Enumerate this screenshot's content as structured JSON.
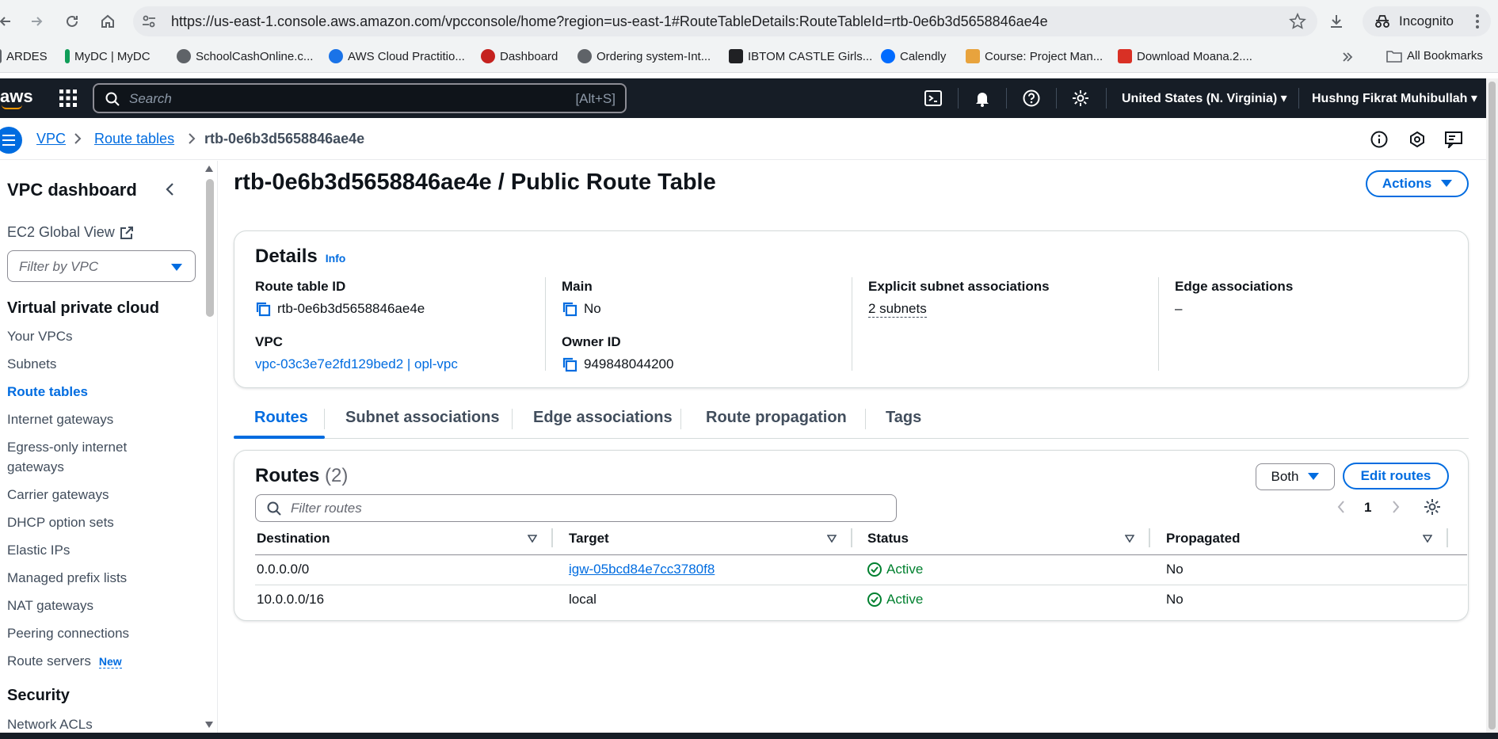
{
  "browser": {
    "url": "https://us-east-1.console.aws.amazon.com/vpcconsole/home?region=us-east-1#RouteTableDetails:RouteTableId=rtb-0e6b3d5658846ae4e",
    "profile_label": "Incognito",
    "bookmarks": [
      {
        "label": "ARDES",
        "color": "#5f6368"
      },
      {
        "label": "MyDC | MyDC",
        "color": "#0f9d58"
      },
      {
        "label": "SchoolCashOnline.c...",
        "color": "#5f6368"
      },
      {
        "label": "AWS Cloud Practitio...",
        "color": "#1a73e8"
      },
      {
        "label": "Dashboard",
        "color": "#c5221f"
      },
      {
        "label": "Ordering system-Int...",
        "color": "#5f6368"
      },
      {
        "label": "IBTOM CASTLE Girls...",
        "color": "#202124"
      },
      {
        "label": "Calendly",
        "color": "#006bff"
      },
      {
        "label": "Course: Project Man...",
        "color": "#e8a33d"
      },
      {
        "label": "Download Moana.2....",
        "color": "#d93025"
      }
    ],
    "all_bookmarks_label": "All Bookmarks"
  },
  "aws_nav": {
    "logo": "aws",
    "search_placeholder": "Search",
    "search_shortcut": "[Alt+S]",
    "region": "United States (N. Virginia)",
    "user": "Hushng Fikrat Muhibullah"
  },
  "breadcrumb": {
    "items": [
      "VPC",
      "Route tables"
    ],
    "current": "rtb-0e6b3d5658846ae4e"
  },
  "sidebar": {
    "title": "VPC dashboard",
    "ec2_global_view": "EC2 Global View",
    "filter_placeholder": "Filter by VPC",
    "section_vpc": "Virtual private cloud",
    "items": [
      {
        "label": "Your VPCs"
      },
      {
        "label": "Subnets"
      },
      {
        "label": "Route tables"
      },
      {
        "label": "Internet gateways"
      },
      {
        "label": "Egress-only internet gateways"
      },
      {
        "label": "Carrier gateways"
      },
      {
        "label": "DHCP option sets"
      },
      {
        "label": "Elastic IPs"
      },
      {
        "label": "Managed prefix lists"
      },
      {
        "label": "NAT gateways"
      },
      {
        "label": "Peering connections"
      },
      {
        "label": "Route servers"
      }
    ],
    "new_badge": "New",
    "section_security": "Security",
    "security_items": [
      {
        "label": "Network ACLs"
      }
    ]
  },
  "page": {
    "title": "rtb-0e6b3d5658846ae4e / Public Route Table",
    "actions_label": "Actions"
  },
  "details": {
    "title": "Details",
    "info": "Info",
    "route_table_id_label": "Route table ID",
    "route_table_id": "rtb-0e6b3d5658846ae4e",
    "vpc_label": "VPC",
    "vpc_value": "vpc-03c3e7e2fd129bed2 | opl-vpc",
    "main_label": "Main",
    "main_value": "No",
    "owner_label": "Owner ID",
    "owner_value": "949848044200",
    "explicit_label": "Explicit subnet associations",
    "explicit_value": "2 subnets",
    "edge_label": "Edge associations",
    "edge_value": "–"
  },
  "tabs": [
    "Routes",
    "Subnet associations",
    "Edge associations",
    "Route propagation",
    "Tags"
  ],
  "routes": {
    "title": "Routes",
    "count": "(2)",
    "both_label": "Both",
    "edit_label": "Edit routes",
    "filter_placeholder": "Filter routes",
    "page": "1",
    "columns": [
      "Destination",
      "Target",
      "Status",
      "Propagated"
    ],
    "rows": [
      {
        "destination": "0.0.0.0/0",
        "target": "igw-05bcd84e7cc3780f8",
        "status": "Active",
        "propagated": "No"
      },
      {
        "destination": "10.0.0.0/16",
        "target": "local",
        "status": "Active",
        "propagated": "No"
      }
    ]
  }
}
